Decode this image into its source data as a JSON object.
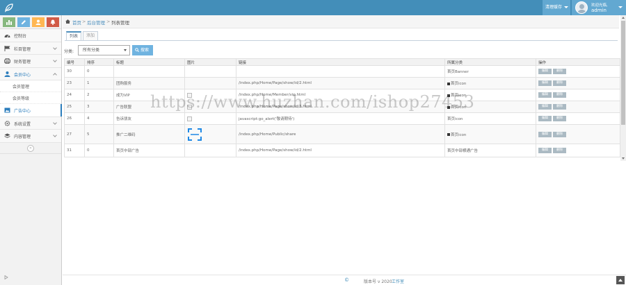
{
  "topbar": {
    "cache_label": "清理缓存",
    "user_welcome": "欢迎光临,",
    "user_name": "admin"
  },
  "sidebar": {
    "shortcuts": [
      {
        "icon": "stats-icon",
        "color": "#87b87f"
      },
      {
        "icon": "pencil-icon",
        "color": "#6fb3e0"
      },
      {
        "icon": "users-icon",
        "color": "#ffb752"
      },
      {
        "icon": "cogs-icon",
        "color": "#d15b47"
      }
    ],
    "items": [
      {
        "label": "控制台",
        "icon": "dashboard-icon"
      },
      {
        "label": "栏目管理",
        "icon": "flag-icon"
      },
      {
        "label": "财务管理",
        "icon": "printer-icon"
      },
      {
        "label": "会员中心",
        "icon": "user-icon"
      },
      {
        "label": "广告中心",
        "icon": "picture-icon"
      },
      {
        "label": "系统设置",
        "icon": "gear-icon"
      },
      {
        "label": "内容管理",
        "icon": "layers-icon"
      }
    ],
    "sub_items": [
      "会员管理",
      "会员等级"
    ]
  },
  "breadcrumb": {
    "home": "首页",
    "sep": ">",
    "level2": "后台管理",
    "current": "列表管理"
  },
  "tabs": [
    "列表",
    "添加"
  ],
  "filter": {
    "label": "分类:",
    "selected": "所有分类",
    "search_label": "搜索"
  },
  "table": {
    "headers": [
      "编号",
      "排序",
      "标题",
      "图片",
      "链接",
      "所属分类",
      "操作"
    ],
    "rows": [
      {
        "id": "30",
        "sort": "0",
        "title": "",
        "image": "",
        "link": "",
        "category": "首页Banner"
      },
      {
        "id": "23",
        "sort": "1",
        "title": "团购服务",
        "image": "",
        "link": "/index.php/Home/Page/show/id/2.html",
        "category": "首页icon"
      },
      {
        "id": "24",
        "sort": "2",
        "title": "成为VIP",
        "image": "broken",
        "link": "/index.php/Home/Member/vip.html",
        "category": "首页icon"
      },
      {
        "id": "25",
        "sort": "3",
        "title": "广告联盟",
        "image": "broken",
        "link": "/index.php/Home/Page/show/id/3.html",
        "category": "首页icon"
      },
      {
        "id": "26",
        "sort": "4",
        "title": "告诉朋友",
        "image": "broken",
        "link": "javascript:go_alert('敬请期待')",
        "category": "首页icon"
      },
      {
        "id": "27",
        "sort": "5",
        "title": "推广二维码",
        "image": "scan",
        "link": "/index.php/Home/Public/share",
        "category": "首页icon"
      },
      {
        "id": "31",
        "sort": "0",
        "title": "首页中部广告",
        "image": "",
        "link": "/index.php/Home/Page/show/id/2.html",
        "category": "首页中部横通广告"
      }
    ],
    "edit_label": "编辑",
    "delete_label": "删除"
  },
  "footer": {
    "copyright": "©",
    "version": "版本号 v 2020",
    "studio": "工作室"
  },
  "watermark": "https://www.huzhan.com/ishop27453",
  "colors": {
    "topbar": "#438eb9",
    "accent": "#62a8d1",
    "link": "#4c8fbd",
    "op_button": "#abbac3",
    "search_button": "#6fb3e0"
  }
}
